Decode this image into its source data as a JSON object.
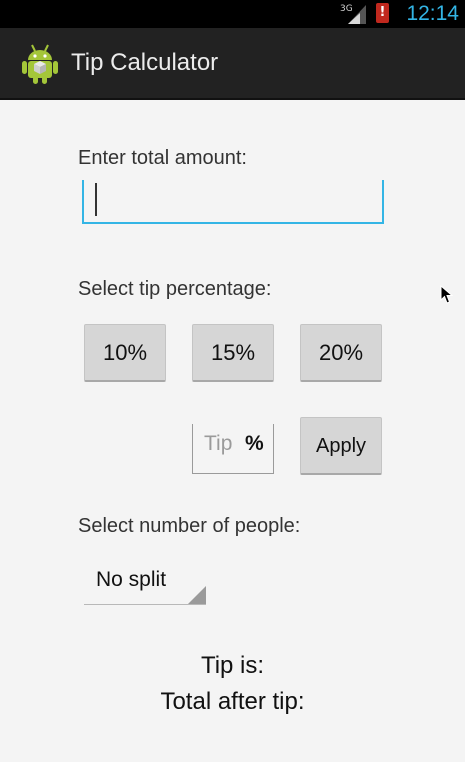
{
  "status_bar": {
    "network": "3G",
    "alert_mark": "!",
    "time": "12:14",
    "accent_color": "#33b5e5"
  },
  "action_bar": {
    "title": "Tip Calculator",
    "icon": "android-robot-icon"
  },
  "form": {
    "amount_label": "Enter total amount:",
    "amount_value": "",
    "tip_label": "Select tip percentage:",
    "tip_buttons": [
      "10%",
      "15%",
      "20%"
    ],
    "custom_tip_placeholder": "Tip",
    "custom_tip_suffix": "%",
    "apply_label": "Apply",
    "people_label": "Select number of people:",
    "people_selected": "No split"
  },
  "results": {
    "tip_label": "Tip is:",
    "total_label": "Total after tip:"
  }
}
